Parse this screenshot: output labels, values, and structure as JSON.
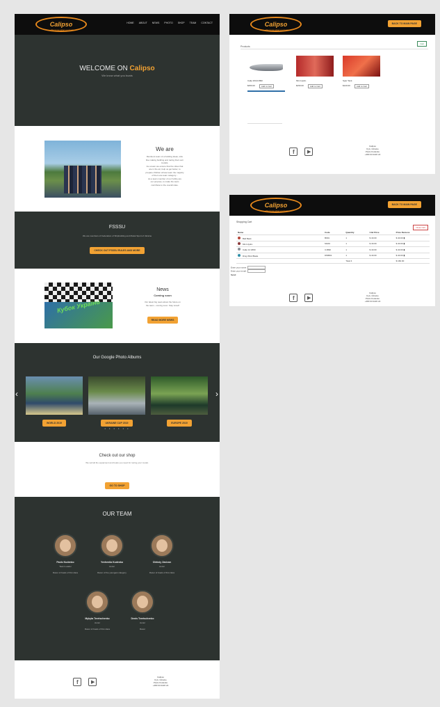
{
  "brand": {
    "logo": "Calipso",
    "tagline": "We know what you boats"
  },
  "nav": [
    "HOME",
    "ABOUT",
    "NEWS",
    "PHOTO",
    "SHOP",
    "TEAM",
    "CONTACT"
  ],
  "hero": {
    "prefix": "WELCOME ON",
    "highlight": "Calipso",
    "subtitle": "We know what you boats"
  },
  "we_are": {
    "title": "We are",
    "lines": [
      "Members team of a building ideas, who",
      "like making building and racing their own",
      "models.",
      "As a team we ensure that the vibes that",
      "are in the air, help us get better, to",
      "prepare children whose team the majority",
      "of them are team category...",
      "As a team member of our hobby are",
      "our purpose, to make the team",
      "contribute to the overall cake."
    ]
  },
  "fssu": {
    "title": "FSSSU",
    "text": "We are members of Federation of Shipbuilding and Model Sport of Ukraine",
    "button": "CHECK OUT FSSSU RULES AND MORE"
  },
  "news": {
    "title": "News",
    "subtitle": "Coming soon",
    "lines": [
      "Our latest big news about the future on",
      "the team - coming soon. Stay tuned!"
    ],
    "button": "READ MORE NEWS",
    "image_text": "Кубок України"
  },
  "albums": {
    "title": "Our Google Photo Albums",
    "items": [
      "WORLD 2019",
      "UKRAINE CUP 2019",
      "EUROPE 2019"
    ]
  },
  "shop": {
    "title": "Check out our shop",
    "text": "We sell all the equipment and boats you need for racing your model.",
    "button": "GO TO SHOP"
  },
  "team": {
    "title": "OUR TEAM",
    "members": [
      {
        "name": "Pavlo Kudenko",
        "role": "Team Leader",
        "quote": "Racer of boats of first class"
      },
      {
        "name": "Yevheniia Kudenko",
        "role": "Junior",
        "quote": "Racer of the youngest category"
      },
      {
        "name": "Oleksiy Zavizon",
        "role": "Junior",
        "quote": "Racer of boats of first class"
      },
      {
        "name": "Mykyta Teretschenko",
        "role": "Junior",
        "quote": "Racer of boats of first class"
      },
      {
        "name": "Denis Teretschenko",
        "role": "Junior",
        "quote": "Racer"
      }
    ]
  },
  "footer": {
    "lines": [
      "Calipso",
      "Kyiv, Ukraine",
      "Pavlo Kudenko",
      "+380 93 0220 22"
    ]
  },
  "shop_page": {
    "cart_button": "BACK TO MAIN PAGE",
    "category": "Products",
    "cart_link": "Cart",
    "products": [
      {
        "name": "Calip 2014/1890",
        "price": "$250.00"
      },
      {
        "name": "Mini Hydro",
        "price": "$150.00"
      },
      {
        "name": "Spar Tank",
        "price": "$120.00"
      }
    ],
    "add_label": "Add to Cart"
  },
  "cart_page": {
    "cart_button": "BACK TO MAIN PAGE",
    "heading": "Shopping Cart",
    "clear_button": "Clear Cart",
    "headers": [
      "Name",
      "Code",
      "Quantity",
      "Unit Price",
      "Price Remove"
    ],
    "rows": [
      {
        "name": "Ball Bank",
        "code": "B001",
        "qty": "1",
        "unit": "$ 40.00",
        "price": "$ 40.00"
      },
      {
        "name": "Mini Hydro",
        "code": "MH01",
        "qty": "1",
        "unit": "$ 40.00",
        "price": "$ 40.00"
      },
      {
        "name": "Calip 14 1890",
        "code": "C1890",
        "qty": "1",
        "unit": "$ 40.00",
        "price": "$ 40.00"
      },
      {
        "name": "Ding Wind Blade",
        "code": "DWB01",
        "qty": "1",
        "unit": "$ 40.00",
        "price": "$ 40.00"
      }
    ],
    "total_label": "Total",
    "total_qty": "4",
    "total_price": "$ 160.00",
    "name_label": "Enter your name:",
    "email_label": "Enter your email:",
    "send": "Send"
  }
}
